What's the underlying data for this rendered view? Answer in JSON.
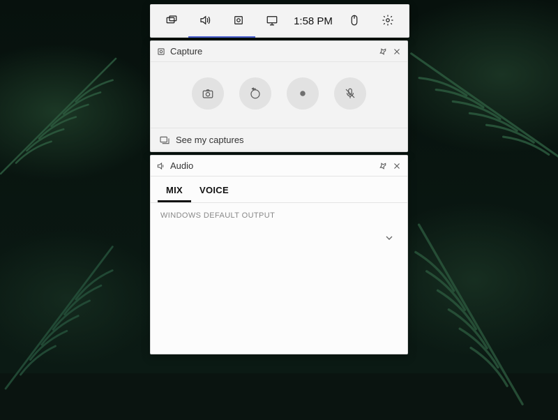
{
  "toolbar": {
    "time": "1:58 PM"
  },
  "capture": {
    "title": "Capture",
    "see_captures": "See my captures"
  },
  "audio": {
    "title": "Audio",
    "tabs": {
      "mix": "MIX",
      "voice": "VOICE"
    },
    "output_label": "WINDOWS DEFAULT OUTPUT"
  }
}
